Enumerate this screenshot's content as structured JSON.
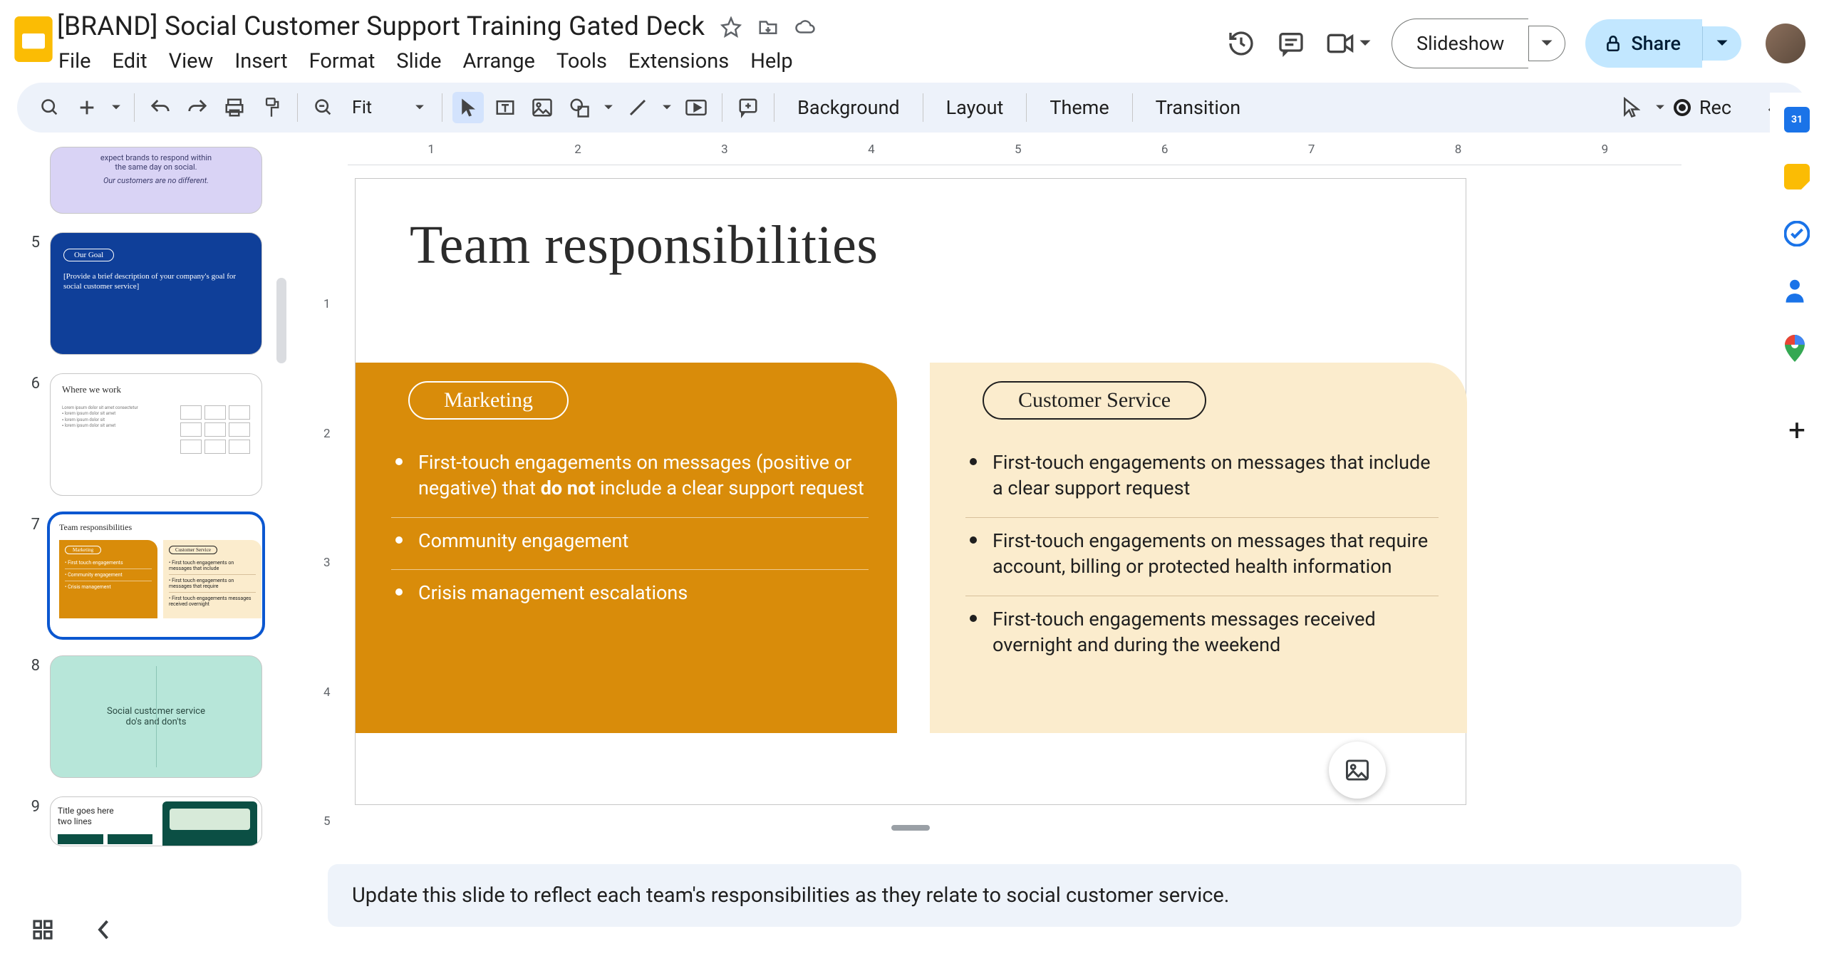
{
  "doc": {
    "title": "[BRAND] Social Customer Support Training Gated Deck"
  },
  "menus": [
    "File",
    "Edit",
    "View",
    "Insert",
    "Format",
    "Slide",
    "Arrange",
    "Tools",
    "Extensions",
    "Help"
  ],
  "titlebar_buttons": {
    "slideshow": "Slideshow",
    "share": "Share"
  },
  "toolbar": {
    "zoom": "Fit",
    "background": "Background",
    "layout": "Layout",
    "theme": "Theme",
    "transition": "Transition",
    "rec": "Rec"
  },
  "ruler": {
    "h": [
      " ",
      "1",
      "2",
      "3",
      "4",
      "5",
      "6",
      "7",
      "8",
      "9"
    ],
    "v": [
      "",
      "1",
      "2",
      "3",
      "4",
      "5"
    ]
  },
  "filmstrip": {
    "visible_numbers": [
      "5",
      "6",
      "7",
      "8",
      "9"
    ],
    "s4_line1": "expect brands to respond within",
    "s4_line2": "the same day on social.",
    "s4_line3": "Our customers are no different.",
    "s5_chip": "Our Goal",
    "s5_body": "[Provide a brief description of your company's goal for social customer service]",
    "s6_title": "Where we work",
    "s7_title": "Team responsibilities",
    "s7_chip1": "Marketing",
    "s7_chip2": "Customer Service",
    "s8_line1": "Social customer service",
    "s8_line2": "do's and don'ts",
    "s9_line1": "Title goes here",
    "s9_line2": "two lines"
  },
  "slide": {
    "title": "Team responsibilities",
    "marketing": {
      "chip": "Marketing",
      "items": [
        "First-touch engagements on messages (positive or negative) that ",
        "do not",
        " include a clear support request",
        "Community engagement",
        "Crisis management escalations"
      ]
    },
    "customer_service": {
      "chip": "Customer Service",
      "items": [
        "First-touch engagements on messages that include a clear support request",
        "First-touch engagements on messages that require account, billing or protected health information",
        "First-touch engagements messages received overnight and during the weekend"
      ]
    }
  },
  "notes": "Update this slide to reflect each team's responsibilities as they relate to social customer service.",
  "sidepanel": {
    "cal_day": "31"
  }
}
